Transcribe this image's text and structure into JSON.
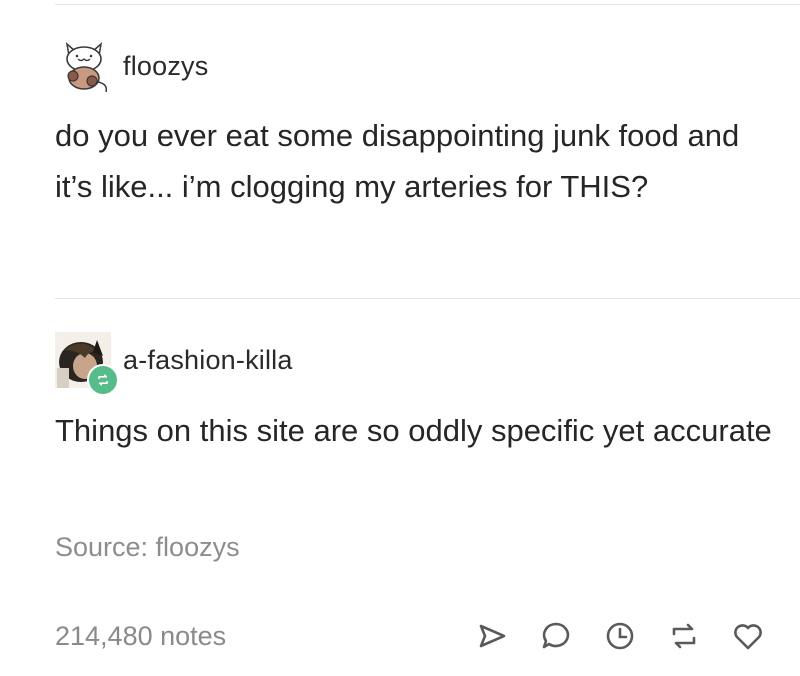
{
  "post": {
    "author": "floozys",
    "text": "do you ever eat some disappointing junk food and it’s like... i’m clogging my arteries for THIS?"
  },
  "reblog": {
    "author": "a-fashion-killa",
    "text": "Things on this site are so oddly specific yet accurate"
  },
  "source": "Source: floozys",
  "footer": {
    "notes": "214,480 notes",
    "actions": [
      "share-icon",
      "reply-icon",
      "clock-icon",
      "reblog-icon",
      "heart-icon"
    ]
  },
  "colors": {
    "reblog_badge": "#56bc8a",
    "muted_text": "#8d8d8d",
    "icon": "#5a5a5a"
  }
}
